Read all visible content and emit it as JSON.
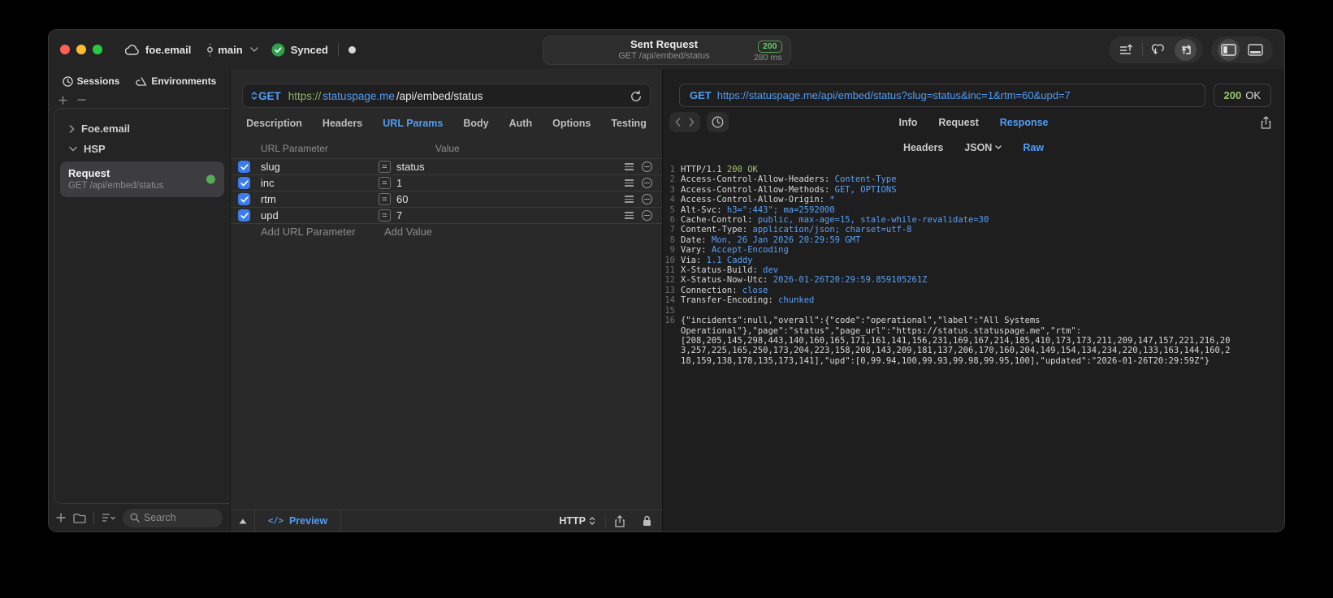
{
  "colors": {
    "accent_blue": "#4f9df8",
    "success_green": "#67c967",
    "code_value_blue": "#58a0f5",
    "code_green": "#9ec36e",
    "url_scheme_green": "#8fae6e",
    "checkbox_blue": "#3b7df0",
    "window_bg": "#242424"
  },
  "titlebar": {
    "project": "foe.email",
    "branch": "main",
    "sync_label": "Synced",
    "center": {
      "title": "Sent Request",
      "method_path": "GET /api/embed/status",
      "status_code": "200",
      "duration": "280 ms"
    }
  },
  "sidebar": {
    "tabs": [
      {
        "label": "Sessions"
      },
      {
        "label": "Environments"
      }
    ],
    "tree": [
      {
        "label": "Foe.email",
        "expanded": false
      },
      {
        "label": "HSP",
        "expanded": true
      }
    ],
    "request_item": {
      "title": "Request",
      "subtitle": "GET /api/embed/status"
    },
    "search_placeholder": "Search"
  },
  "request_panel": {
    "method": "GET",
    "url": {
      "scheme": "https://",
      "host": "statuspage.me",
      "path": "/api/embed/status"
    },
    "tabs": [
      "Description",
      "Headers",
      "URL Params",
      "Body",
      "Auth",
      "Options",
      "Testing"
    ],
    "active_tab": "URL Params",
    "params": {
      "columns": {
        "name": "URL Parameter",
        "value": "Value"
      },
      "rows": [
        {
          "name": "slug",
          "value": "status",
          "enabled": true
        },
        {
          "name": "inc",
          "value": "1",
          "enabled": true
        },
        {
          "name": "rtm",
          "value": "60",
          "enabled": true
        },
        {
          "name": "upd",
          "value": "7",
          "enabled": true
        }
      ],
      "add_name_placeholder": "Add URL Parameter",
      "add_value_placeholder": "Add Value"
    },
    "footer": {
      "code_glyph": "</>",
      "preview_label": "Preview",
      "format_label": "HTTP"
    }
  },
  "response_panel": {
    "request_line": {
      "method": "GET",
      "url": "https://statuspage.me/api/embed/status?slug=status&inc=1&rtm=60&upd=7"
    },
    "status": {
      "code": "200",
      "text": "OK"
    },
    "tabs": [
      {
        "label": "Info"
      },
      {
        "label": "Request"
      },
      {
        "label": "Response",
        "active": true
      }
    ],
    "subtabs": [
      {
        "label": "Headers"
      },
      {
        "label": "JSON",
        "chevron": true
      },
      {
        "label": "Raw",
        "active": true
      }
    ],
    "body_lines": [
      {
        "n": "1",
        "segs": [
          {
            "t": "HTTP/1.1 ",
            "c": "w"
          },
          {
            "t": "200 OK",
            "c": "g"
          }
        ]
      },
      {
        "n": "2",
        "segs": [
          {
            "t": "Access-Control-Allow-Headers: ",
            "c": "w"
          },
          {
            "t": "Content-Type",
            "c": "b"
          }
        ]
      },
      {
        "n": "3",
        "segs": [
          {
            "t": "Access-Control-Allow-Methods: ",
            "c": "w"
          },
          {
            "t": "GET, OPTIONS",
            "c": "b"
          }
        ]
      },
      {
        "n": "4",
        "segs": [
          {
            "t": "Access-Control-Allow-Origin: ",
            "c": "w"
          },
          {
            "t": "*",
            "c": "b"
          }
        ]
      },
      {
        "n": "5",
        "segs": [
          {
            "t": "Alt-Svc: ",
            "c": "w"
          },
          {
            "t": "h3=\":443\"; ma=2592000",
            "c": "b"
          }
        ]
      },
      {
        "n": "6",
        "segs": [
          {
            "t": "Cache-Control: ",
            "c": "w"
          },
          {
            "t": "public, max-age=15, stale-while-revalidate=30",
            "c": "b"
          }
        ]
      },
      {
        "n": "7",
        "segs": [
          {
            "t": "Content-Type: ",
            "c": "w"
          },
          {
            "t": "application/json; charset=utf-8",
            "c": "b"
          }
        ]
      },
      {
        "n": "8",
        "segs": [
          {
            "t": "Date: ",
            "c": "w"
          },
          {
            "t": "Mon, 26 Jan 2026 20:29:59 GMT",
            "c": "b"
          }
        ]
      },
      {
        "n": "9",
        "segs": [
          {
            "t": "Vary: ",
            "c": "w"
          },
          {
            "t": "Accept-Encoding",
            "c": "b"
          }
        ]
      },
      {
        "n": "10",
        "segs": [
          {
            "t": "Via: ",
            "c": "w"
          },
          {
            "t": "1.1 Caddy",
            "c": "b"
          }
        ]
      },
      {
        "n": "11",
        "segs": [
          {
            "t": "X-Status-Build: ",
            "c": "w"
          },
          {
            "t": "dev",
            "c": "b"
          }
        ]
      },
      {
        "n": "12",
        "segs": [
          {
            "t": "X-Status-Now-Utc: ",
            "c": "w"
          },
          {
            "t": "2026-01-26T20:29:59.859105261Z",
            "c": "b"
          }
        ]
      },
      {
        "n": "13",
        "segs": [
          {
            "t": "Connection: ",
            "c": "w"
          },
          {
            "t": "close",
            "c": "b"
          }
        ]
      },
      {
        "n": "14",
        "segs": [
          {
            "t": "Transfer-Encoding: ",
            "c": "w"
          },
          {
            "t": "chunked",
            "c": "b"
          }
        ]
      },
      {
        "n": "15",
        "segs": []
      },
      {
        "n": "16",
        "segs": [
          {
            "t": "{\"incidents\":null,\"overall\":{\"code\":\"operational\",\"label\":\"All Systems Operational\"},\"page\":\"status\",\"page_url\":\"https://status.statuspage.me\",\"rtm\":[208,205,145,298,443,140,160,165,171,161,141,156,231,169,167,214,185,410,173,173,211,209,147,157,221,216,203,257,225,165,250,173,204,223,158,208,143,209,181,137,206,170,160,204,149,154,134,234,220,133,163,144,160,218,159,138,178,135,173,141],\"upd\":[0,99.94,100,99.93,99.98,99.95,100],\"updated\":\"2026-01-26T20:29:59Z\"}",
            "c": "w"
          }
        ]
      }
    ]
  }
}
